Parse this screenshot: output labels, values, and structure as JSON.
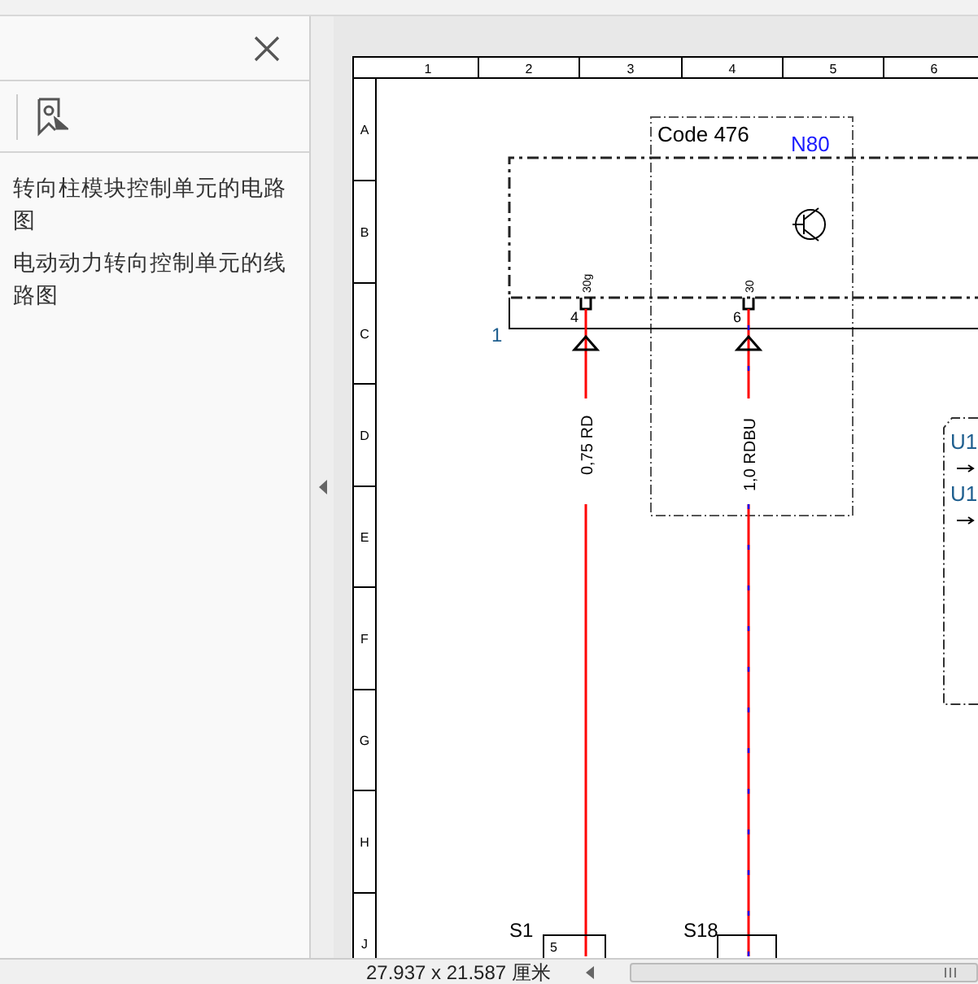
{
  "sidebar": {
    "bookmarks": [
      {
        "label": "转向柱模块控制单元的电路图",
        "selected": false
      },
      {
        "label": "电动动力转向控制单元的线路图",
        "selected": false
      }
    ]
  },
  "diagram": {
    "column_labels": [
      "1",
      "2",
      "3",
      "4",
      "5",
      "6"
    ],
    "row_labels": [
      "A",
      "B",
      "C",
      "D",
      "E",
      "F",
      "G",
      "H",
      "J"
    ],
    "option_box": {
      "label": "Code 476"
    },
    "component": {
      "label": "N80"
    },
    "connector": {
      "label": "1"
    },
    "pins": [
      {
        "number": "4",
        "terminal": "30g",
        "wire_label": "0,75 RD",
        "kind": "plain"
      },
      {
        "number": "6",
        "terminal": "30",
        "wire_label": "1,0 RDBU",
        "kind": "striped"
      }
    ],
    "side_labels": [
      "U1",
      "U1"
    ],
    "parts": [
      {
        "label": "S1",
        "pin": "5"
      },
      {
        "label": "S18"
      }
    ]
  },
  "status_bar": {
    "page_size": "27.937 x 21.587 厘米"
  }
}
